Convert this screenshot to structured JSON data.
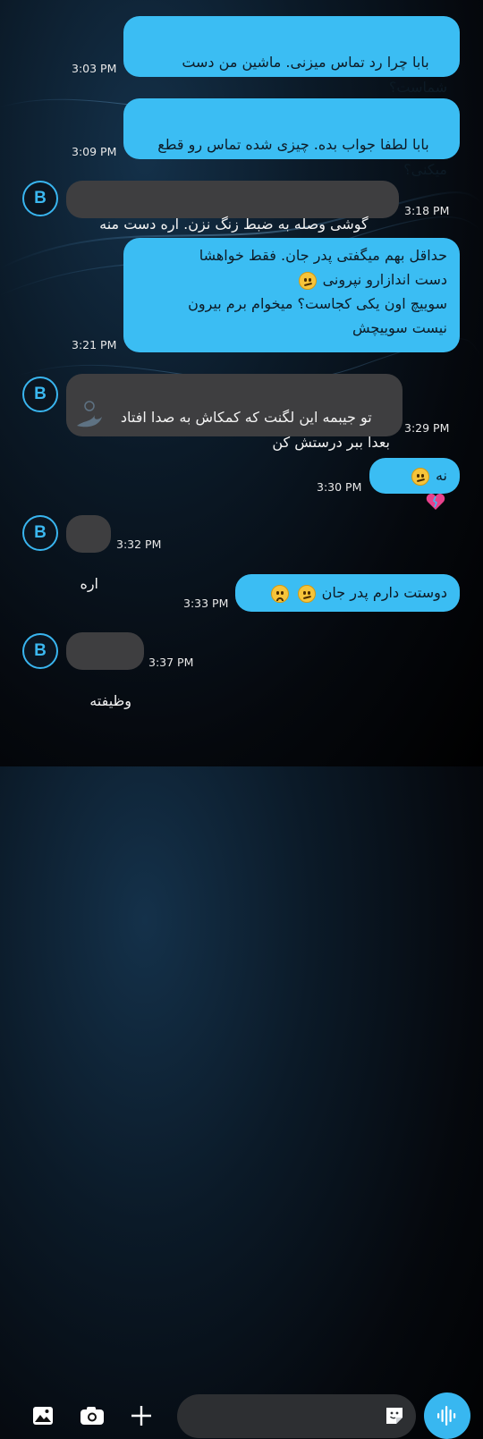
{
  "colors": {
    "outgoing_bubble": "#3bbdf3",
    "incoming_bubble": "#3e3e40",
    "accent": "#38b7f0"
  },
  "contact": {
    "initial": "B"
  },
  "messages": [
    {
      "dir": "out",
      "text": "بابا چرا رد تماس میزنی. ماشین من دست\nشماست؟",
      "time": "3:03 PM"
    },
    {
      "dir": "out",
      "text": "بابا لطفا جواب بده. چیزی شده تماس رو قطع\nمیکنی؟",
      "time": "3:09 PM"
    },
    {
      "dir": "in",
      "text": "گوشی وصله به ضبط زنگ نزن. اره دست منه",
      "time": "3:18 PM"
    },
    {
      "dir": "out",
      "line1": "حداقل بهم میگفتی پدر جان. فقط خواهشا",
      "line2": "دست اندازارو نپرونی",
      "line3": "سوییچ اون یکی کجاست؟ میخوام برم بیرون",
      "line4": "نیست سوییچش",
      "emoji": "confused-face-icon",
      "time": "3:21 PM"
    },
    {
      "dir": "in",
      "text": "تو جیبمه این لگنت که کمکاش به صدا افتاد\nبعدا ببر درستش کن",
      "time": "3:29 PM"
    },
    {
      "dir": "out",
      "text": "نه",
      "emojis": [
        "confused-face-icon",
        "broken-heart-icon"
      ],
      "time": "3:30 PM"
    },
    {
      "dir": "in",
      "text": "اره",
      "time": "3:32 PM"
    },
    {
      "dir": "out",
      "text": "دوستت دارم پدر جان",
      "emojis": [
        "confused-face-icon",
        "sad-face-icon"
      ],
      "time": "3:33 PM"
    },
    {
      "dir": "in",
      "text": "وظیفته",
      "time": "3:37 PM"
    }
  ],
  "composer": {
    "icons": [
      "gallery-icon",
      "camera-icon",
      "plus-icon",
      "sticker-icon",
      "voice-icon"
    ],
    "placeholder": ""
  }
}
